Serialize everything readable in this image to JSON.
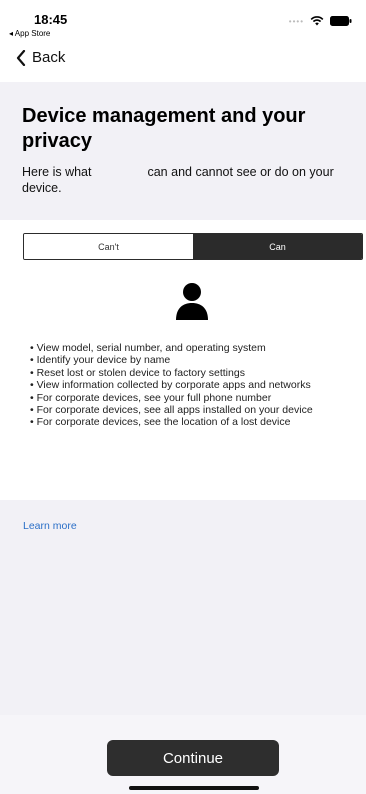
{
  "status_bar": {
    "time": "18:45",
    "back_app": "◂ App Store",
    "icons": [
      "wifi-icon",
      "battery-icon"
    ]
  },
  "nav": {
    "back_label": "Back",
    "back_icon": "chevron-left-icon"
  },
  "header": {
    "title": "Device management and your privacy",
    "intro_before": "Here is what",
    "intro_after": "can and cannot see or do on your device."
  },
  "tabs": {
    "cant_label": "Can't",
    "can_label": "Can",
    "selected": "Can"
  },
  "person_icon": "person-icon",
  "can_items": [
    "View model, serial number, and operating system",
    "Identify your device by name",
    "Reset lost or stolen device to factory settings",
    "View information collected by corporate apps and networks",
    "For corporate devices, see your full phone number",
    "For corporate devices, see all apps installed on your device",
    "For corporate devices, see the location of a lost device"
  ],
  "learn_more": "Learn more",
  "continue_label": "Continue",
  "colors": {
    "accent_link": "#2b6fc7",
    "button_dark": "#2e2e2e",
    "background": "#f2f1f6"
  }
}
